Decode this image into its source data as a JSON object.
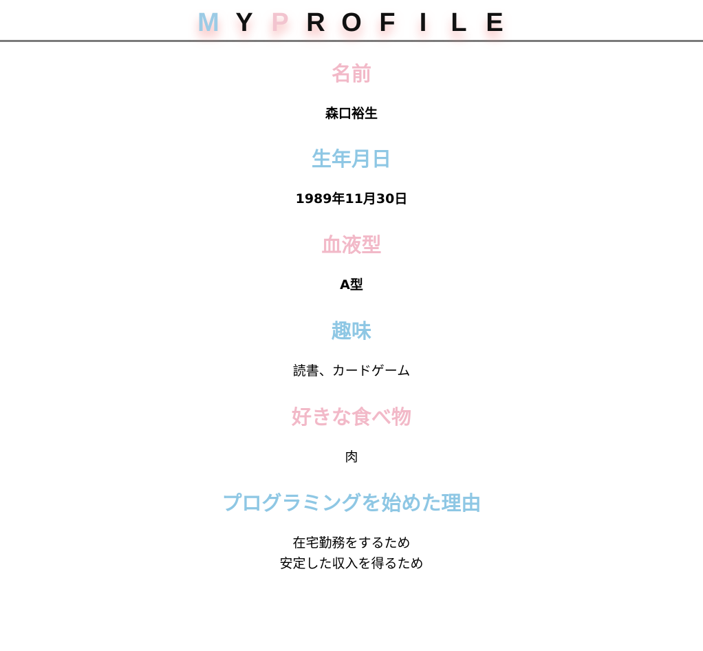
{
  "header": {
    "letters": [
      {
        "char": "M",
        "color": "#9ccbe5"
      },
      {
        "char": "Y",
        "color": "#111111"
      },
      {
        "char": "P",
        "color": "#f2c4cf"
      },
      {
        "char": "R",
        "color": "#111111"
      },
      {
        "char": "O",
        "color": "#111111"
      },
      {
        "char": "F",
        "color": "#111111"
      },
      {
        "char": "I",
        "color": "#111111"
      },
      {
        "char": "L",
        "color": "#111111"
      },
      {
        "char": "E",
        "color": "#111111"
      }
    ]
  },
  "colors": {
    "pink": "#f2b9c8",
    "blue": "#8ec7e4",
    "divider": "#7a7a7a"
  },
  "sections": [
    {
      "heading": "名前",
      "heading_color": "pink",
      "lines": [
        "森口裕生"
      ],
      "bold": true
    },
    {
      "heading": "生年月日",
      "heading_color": "blue",
      "lines": [
        "1989年11月30日"
      ],
      "bold": true
    },
    {
      "heading": "血液型",
      "heading_color": "pink",
      "lines": [
        "A型"
      ],
      "bold": true
    },
    {
      "heading": "趣味",
      "heading_color": "blue",
      "lines": [
        "読書、カードゲーム"
      ],
      "bold": false
    },
    {
      "heading": "好きな食べ物",
      "heading_color": "pink",
      "lines": [
        "肉"
      ],
      "bold": false
    },
    {
      "heading": "プログラミングを始めた理由",
      "heading_color": "blue",
      "lines": [
        "在宅勤務をするため",
        "安定した収入を得るため"
      ],
      "bold": false
    }
  ]
}
